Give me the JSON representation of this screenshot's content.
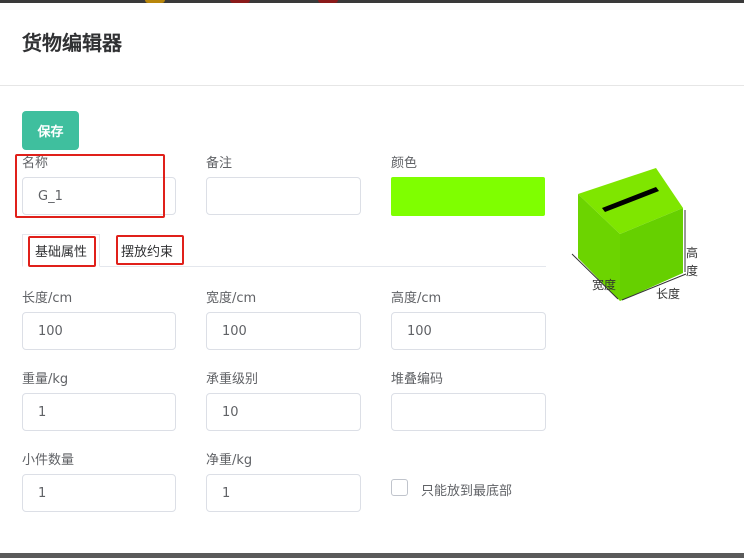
{
  "title": "货物编辑器",
  "toolbar": {
    "save_label": "保存"
  },
  "fields": {
    "name": {
      "label": "名称",
      "value": "G_1"
    },
    "remark": {
      "label": "备注",
      "value": ""
    },
    "color": {
      "label": "颜色",
      "value": "#7fff00"
    },
    "length": {
      "label": "长度/cm",
      "value": "100"
    },
    "width": {
      "label": "宽度/cm",
      "value": "100"
    },
    "height": {
      "label": "高度/cm",
      "value": "100"
    },
    "weight": {
      "label": "重量/kg",
      "value": "1"
    },
    "load_level": {
      "label": "承重级别",
      "value": "10"
    },
    "stack_code": {
      "label": "堆叠编码",
      "value": ""
    },
    "piece_count": {
      "label": "小件数量",
      "value": "1"
    },
    "net_weight": {
      "label": "净重/kg",
      "value": "1"
    },
    "bottom_only": {
      "label": "只能放到最底部",
      "checked": false
    }
  },
  "tabs": [
    {
      "label": "基础属性",
      "active": true
    },
    {
      "label": "摆放约束",
      "active": false
    }
  ],
  "preview": {
    "height_chars": [
      "高",
      "度"
    ],
    "width_label": "宽度",
    "length_label": "长度"
  }
}
